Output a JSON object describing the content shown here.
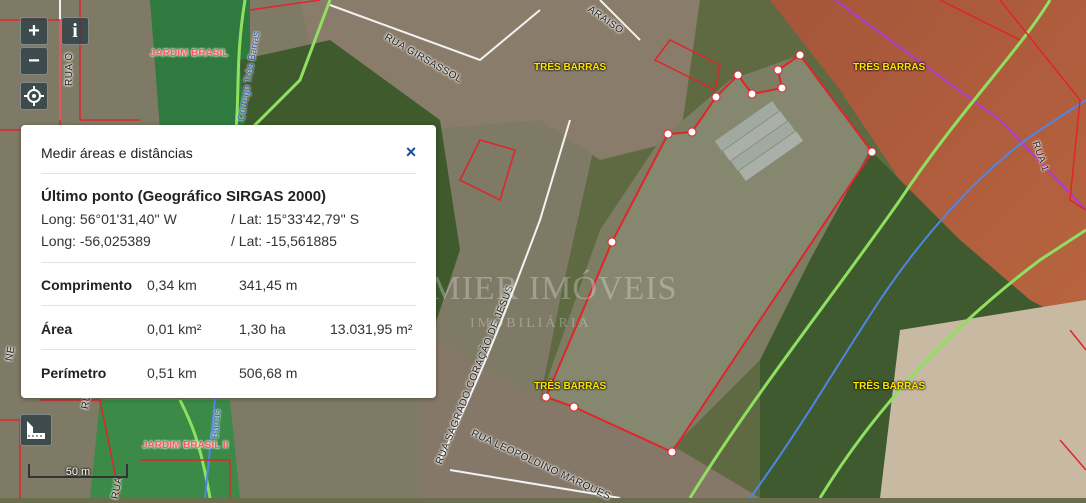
{
  "map": {
    "neighborhood_labels": [
      {
        "text": "JARDIM BRASIL",
        "style": "red"
      },
      {
        "text": "TRÊS BARRAS",
        "style": "yellow"
      },
      {
        "text": "TRÊS BARRAS",
        "style": "yellow"
      },
      {
        "text": "TRÊS BARRAS",
        "style": "yellow"
      },
      {
        "text": "TRÊS BARRAS",
        "style": "yellow"
      },
      {
        "text": "JARDIM BRASIL II",
        "style": "red"
      }
    ],
    "street_labels": [
      "RUA GIRSASSOL",
      "RUA O",
      "ARAISO",
      "RUA 1",
      "RUA SAGRADO CORAÇÃO DE JESUS",
      "RUA LEOPOLDINO MARQUES",
      "RUA J",
      "RUA",
      "NE"
    ],
    "stream_labels": [
      "Córrego Três Barras",
      "Barras"
    ],
    "watermark": {
      "line1": "PREMIER IMÓVEIS",
      "line2": "IMOBILIÁRIA"
    },
    "colors": {
      "parcel_outline": "#e0252b",
      "road_line_green": "#8fe060",
      "road_line_white": "#f2f2f2",
      "stream_line": "#4f86e6",
      "boundary_purple": "#b03bd6",
      "measure_vertex": "#ffffff"
    }
  },
  "controls": {
    "zoom_in": "+",
    "zoom_out": "−",
    "info": "i",
    "locate_icon": "crosshair-icon",
    "measure_icon": "ruler-area-icon"
  },
  "panel": {
    "title": "Medir áreas e distâncias",
    "close": "×",
    "last_point_heading": "Último ponto (Geográfico SIRGAS 2000)",
    "long_dms": "Long: 56°01'31,40'' W",
    "lat_dms": "/ Lat: 15°33'42,79'' S",
    "long_dec": "Long: -56,025389",
    "lat_dec": "/ Lat: -15,561885",
    "rows": {
      "comprimento": {
        "label": "Comprimento",
        "v1": "0,34 km",
        "v2": "341,45 m"
      },
      "area": {
        "label": "Área",
        "v1": "0,01 km²",
        "v2": "1,30 ha",
        "v3": "13.031,95 m²"
      },
      "perimetro": {
        "label": "Perímetro",
        "v1": "0,51 km",
        "v2": "506,68 m"
      }
    }
  },
  "scale": {
    "label": "50 m"
  }
}
